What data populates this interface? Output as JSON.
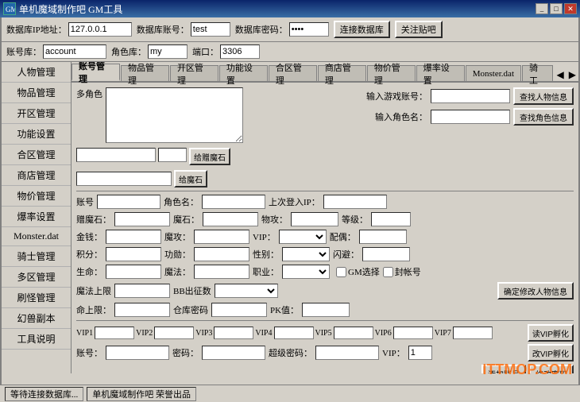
{
  "titleBar": {
    "icon": "GM",
    "title": "单机魔域制作吧 GM工具",
    "minimizeLabel": "_",
    "maximizeLabel": "□",
    "closeLabel": "✕"
  },
  "topBar": {
    "dbIpLabel": "数据库IP地址：",
    "dbIpValue": "127.0.0.1",
    "dbAccountLabel": "数据库账号：",
    "dbAccountValue": "test",
    "dbPassLabel": "数据库密码：",
    "dbPassValue": "****",
    "connectBtn": "连接数据库",
    "closeBtn": "关注贴吧"
  },
  "secondBar": {
    "accountLabel": "账号库：",
    "accountValue": "account",
    "roleLabel": "角色库：",
    "roleValue": "my",
    "portLabel": "端口：",
    "portValue": "3306"
  },
  "leftNav": {
    "items": [
      {
        "label": "人物管理"
      },
      {
        "label": "物品管理"
      },
      {
        "label": "开区管理"
      },
      {
        "label": "功能设置"
      },
      {
        "label": "合区管理"
      },
      {
        "label": "商店管理"
      },
      {
        "label": "物价管理"
      },
      {
        "label": "爆率设置"
      },
      {
        "label": "Monster.dat"
      },
      {
        "label": "骑士管理"
      },
      {
        "label": "多区管理"
      },
      {
        "label": "刷怪管理"
      },
      {
        "label": "幻兽副本"
      },
      {
        "label": "工具说明"
      }
    ]
  },
  "tabs": {
    "items": [
      {
        "label": "账号管理",
        "active": true
      },
      {
        "label": "物品管理"
      },
      {
        "label": "开区管理"
      },
      {
        "label": "功能设置"
      },
      {
        "label": "合区管理"
      },
      {
        "label": "商店管理"
      },
      {
        "label": "物价管理"
      },
      {
        "label": "爆率设置"
      },
      {
        "label": "Monster.dat"
      },
      {
        "label": "骑工"
      }
    ]
  },
  "accountPanel": {
    "multiCharLabel": "多角色",
    "searchGameAccountLabel": "输入游戏账号：",
    "searchRoleNameLabel": "输入角色名：",
    "searchInfoBtn": "查找人物信息",
    "searchRoleBtn": "查找角色信息",
    "giveDevilStoneBtn": "给赠魔石",
    "giveStoneBtn": "给魔石",
    "accountLabel": "账号",
    "roleNameLabel": "角色名：",
    "lastLoginIPLabel": "上次登入IP：",
    "devilStoneLabel": "赠魔石：",
    "stoneLabel": "魔石：",
    "physAtkLabel": "物攻：",
    "levelLabel": "等级：",
    "goldLabel": "金钱：",
    "magicAtkLabel": "魔攻：",
    "vipLabel": "VIP：",
    "partnerLabel": "配偶：",
    "pointsLabel": "积分：",
    "meritLabel": "功勋：",
    "genderLabel": "性别：",
    "flashLabel": "闪避：",
    "lifeLabel": "生命：",
    "magicLabel": "魔法：",
    "jobLabel": "职业：",
    "gmSelectLabel": "GM选择",
    "sealAccountLabel": "封帐号",
    "maxMagicLabel": "魔法上限",
    "bbOutCountLabel": "BB出征数",
    "confirmEditBtn": "确定修改人物信息",
    "lifeMaxLabel": "命上限：",
    "warehousePassLabel": "仓库密码",
    "pkValueLabel": "PK值：",
    "readVipBtn": "读VIP孵化",
    "changeVipBtn": "改VIP孵化",
    "addAccountBtn": "添加账号",
    "changePassBtn": "修改密码",
    "vipFields": [
      "VIP1",
      "VIP2",
      "VIP3",
      "VIP4",
      "VIP5",
      "VIP6",
      "VIP7"
    ],
    "accountLabel2": "账号：",
    "passwordLabel": "密码：",
    "superPassLabel": "超级密码：",
    "vipLabel2": "VIP：",
    "vipValue": "1"
  },
  "statusBar": {
    "waitText": "等待连接数据库...",
    "creditText": "单机魔域制作吧 荣誉出品"
  },
  "watermark": "ITTMOP.COM"
}
